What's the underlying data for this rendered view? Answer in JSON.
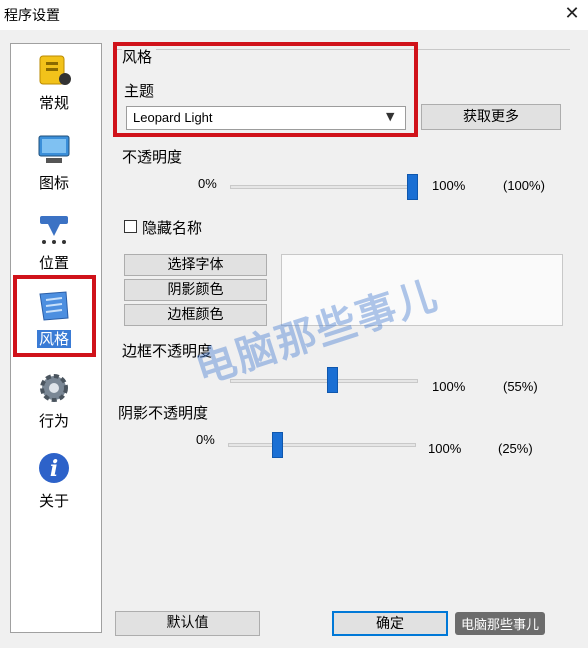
{
  "window": {
    "title": "程序设置"
  },
  "sidebar": {
    "items": [
      {
        "label": "常规",
        "icon": "notebook-icon"
      },
      {
        "label": "图标",
        "icon": "monitor-icon"
      },
      {
        "label": "位置",
        "icon": "placement-icon"
      },
      {
        "label": "风格",
        "icon": "style-icon",
        "selected": true
      },
      {
        "label": "行为",
        "icon": "gear-icon"
      },
      {
        "label": "关于",
        "icon": "info-icon"
      }
    ]
  },
  "style_panel": {
    "section_label": "风格",
    "theme_label": "主题",
    "theme_value": "Leopard Light",
    "get_more_label": "获取更多",
    "opacity_label": "不透明度",
    "opacity_min": "0%",
    "opacity_max": "100%",
    "opacity_value": "(100%)",
    "opacity_fraction": 1.0,
    "hide_name_label": "隐藏名称",
    "choose_font_label": "选择字体",
    "shadow_color_label": "阴影颜色",
    "border_color_label": "边框颜色",
    "border_opacity_label": "边框不透明度",
    "border_opacity_max": "100%",
    "border_opacity_value": "(55%)",
    "border_opacity_fraction": 0.55,
    "shadow_opacity_label": "阴影不透明度",
    "shadow_opacity_min": "0%",
    "shadow_opacity_max": "100%",
    "shadow_opacity_value": "(25%)",
    "shadow_opacity_fraction": 0.25
  },
  "footer": {
    "default_label": "默认值",
    "ok_label": "确定"
  },
  "watermark": {
    "text": "电脑那些事儿",
    "logo_text": "电脑那些事儿"
  },
  "colors": {
    "accent": "#1a6fd4",
    "highlight": "#d0121a"
  }
}
